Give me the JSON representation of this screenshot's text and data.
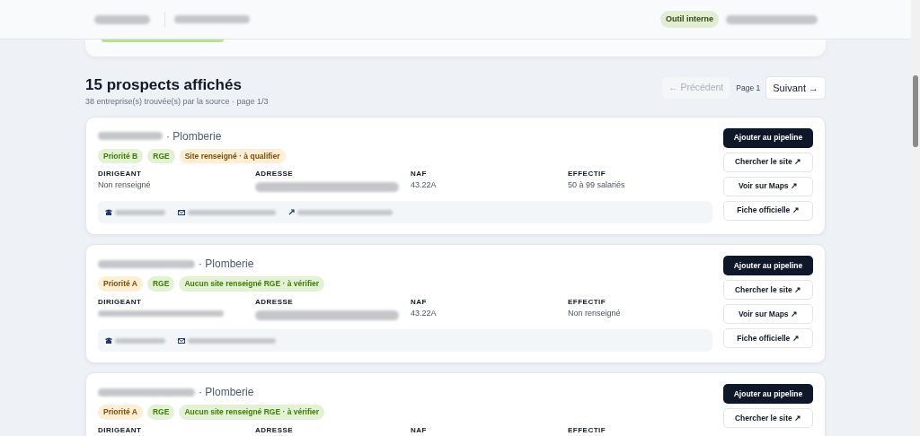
{
  "header": {
    "badge": "Outil interne"
  },
  "results": {
    "title": "15 prospects affichés",
    "subtitle": "38 entreprise(s) trouvée(s) par la source · page 1/3"
  },
  "pagination": {
    "previous": {
      "label": "← Précédent",
      "disabled": true
    },
    "page": "Page 1",
    "next": {
      "label": "Suivant →",
      "disabled": false
    }
  },
  "cards": [
    {
      "category": "· Plomberie",
      "badges": [
        {
          "label": "Priorité B",
          "color": "#e3f1d4"
        },
        {
          "label": "RGE",
          "color": "#e3f1d4"
        },
        {
          "label": "Site renseigné · à qualifier",
          "color": "#fdefd6"
        }
      ],
      "fields": [
        {
          "label": "DIRIGEANT",
          "value": "Non renseigné",
          "redacted": false
        },
        {
          "label": "ADRESSE",
          "redacted": true
        },
        {
          "label": "NAF",
          "value": "43.22A",
          "redacted": false
        },
        {
          "label": "EFFECTIF",
          "value": "50 à 99 salariés",
          "redacted": false
        }
      ],
      "contacts": [
        {
          "kind": "phone"
        },
        {
          "kind": "email"
        },
        {
          "kind": "website"
        }
      ],
      "buttons": [
        {
          "label": "Ajouter au pipeline",
          "kind": "primary"
        },
        {
          "label": "Chercher le site ↗",
          "kind": "secondary"
        },
        {
          "label": "Voir sur Maps ↗",
          "kind": "secondary"
        },
        {
          "label": "Fiche officielle ↗",
          "kind": "secondary"
        }
      ]
    },
    {
      "category": "· Plomberie",
      "badges": [
        {
          "label": "Priorité A",
          "color": "#fdefd6"
        },
        {
          "label": "RGE",
          "color": "#e3f1d4"
        },
        {
          "label": "Aucun site renseigné RGE · à vérifier",
          "color": "#e3f1d4"
        }
      ],
      "fields": [
        {
          "label": "DIRIGEANT",
          "redacted": true
        },
        {
          "label": "ADRESSE",
          "redacted": true
        },
        {
          "label": "NAF",
          "value": "43.22A",
          "redacted": false
        },
        {
          "label": "EFFECTIF",
          "value": "Non renseigné",
          "redacted": false
        }
      ],
      "contacts": [
        {
          "kind": "phone"
        },
        {
          "kind": "email"
        }
      ],
      "buttons": [
        {
          "label": "Ajouter au pipeline",
          "kind": "primary"
        },
        {
          "label": "Chercher le site ↗",
          "kind": "secondary"
        },
        {
          "label": "Voir sur Maps ↗",
          "kind": "secondary"
        },
        {
          "label": "Fiche officielle ↗",
          "kind": "secondary"
        }
      ]
    },
    {
      "category": "· Plomberie",
      "badges": [
        {
          "label": "Priorité A",
          "color": "#fdefd6"
        },
        {
          "label": "RGE",
          "color": "#e3f1d4"
        },
        {
          "label": "Aucun site renseigné RGE · à vérifier",
          "color": "#e3f1d4"
        }
      ],
      "fields": [
        {
          "label": "DIRIGEANT"
        },
        {
          "label": "ADRESSE"
        },
        {
          "label": "NAF"
        },
        {
          "label": "EFFECTIF"
        }
      ],
      "buttons": [
        {
          "label": "Ajouter au pipeline",
          "kind": "primary"
        },
        {
          "label": "Chercher le site ↗",
          "kind": "secondary"
        }
      ]
    }
  ]
}
